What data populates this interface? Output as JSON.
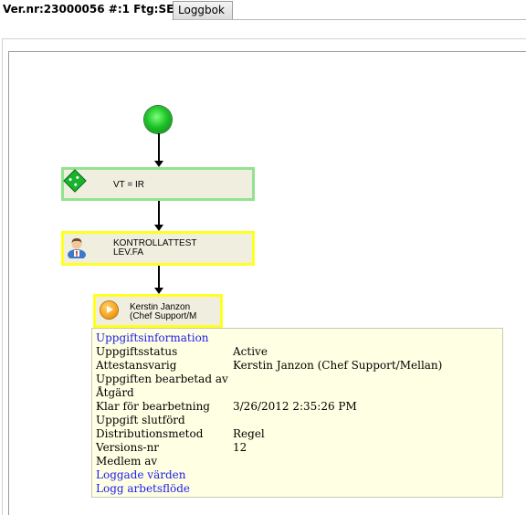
{
  "tabs": [
    {
      "label": "Ver.nr:23000056 #:1 Ftg:SE",
      "active": true
    },
    {
      "label": "Loggbok",
      "active": false
    }
  ],
  "workflow": {
    "start_icon": "start-circle-icon",
    "nodes": [
      {
        "label": "VT = IR",
        "icon": "decision-diamond-icon",
        "border_color": "#93e28f"
      },
      {
        "label_line1": "KONTROLLATTEST",
        "label_line2": "LEV.FA",
        "icon": "person-icon",
        "border_color": "#ffff22"
      },
      {
        "label_line1": "Kerstin Janzon",
        "label_line2": "(Chef Support/M",
        "icon": "play-icon",
        "border_color": "#ffff22"
      }
    ]
  },
  "task_info": {
    "heading": "Uppgiftsinformation",
    "fields": [
      {
        "label": "Uppgiftsstatus",
        "value": "Active"
      },
      {
        "label": "Attestansvarig",
        "value": "Kerstin Janzon (Chef Support/Mellan)"
      },
      {
        "label": "Uppgiften bearbetad av",
        "value": ""
      },
      {
        "label": "Åtgärd",
        "value": ""
      },
      {
        "label": "Klar för bearbetning",
        "value": "3/26/2012 2:35:26 PM"
      },
      {
        "label": "Uppgift slutförd",
        "value": ""
      },
      {
        "label": "Distributionsmetod",
        "value": "Regel"
      },
      {
        "label": "Versions-nr",
        "value": "12"
      },
      {
        "label": "Medlem av",
        "value": ""
      }
    ],
    "links": [
      "Loggade värden",
      "Logg arbetsflöde"
    ],
    "link_color": "#1d1df0",
    "background": "#ffffe3"
  }
}
